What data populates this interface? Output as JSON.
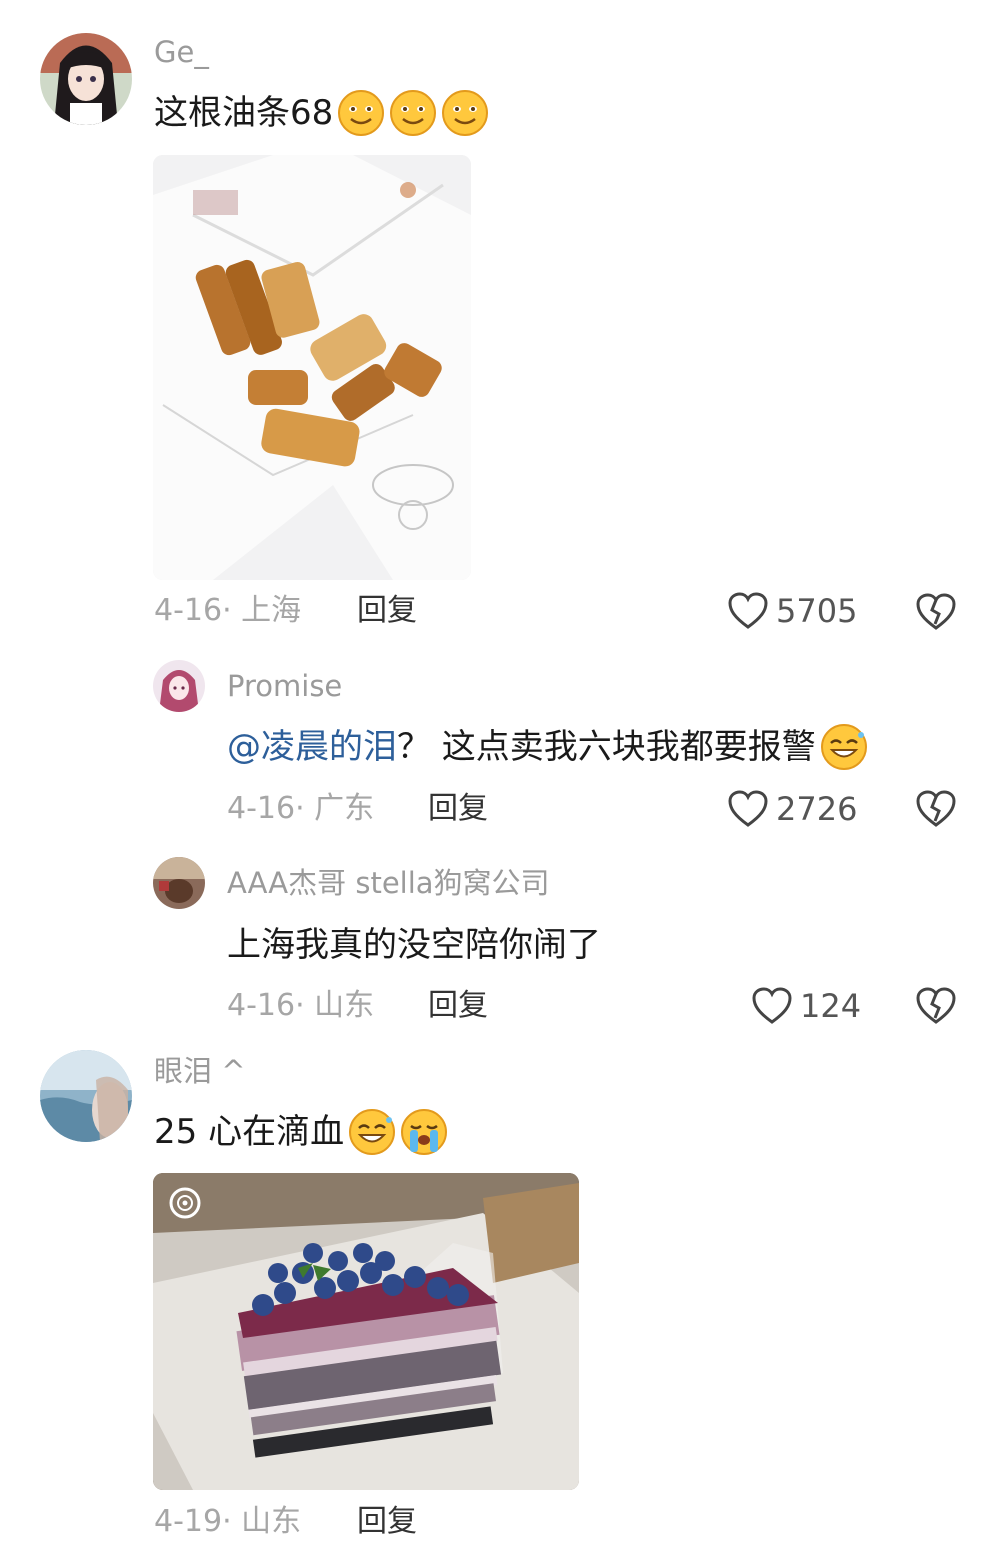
{
  "comments": [
    {
      "username": "Ge_",
      "text": "这根油条68",
      "date_location": "4-16· 上海",
      "reply_label": "回复",
      "likes": "5705"
    },
    {
      "username": "Promise",
      "mention": "@凌晨的泪",
      "text": "？ 这点卖我六块我都要报警",
      "date_location": "4-16· 广东",
      "reply_label": "回复",
      "likes": "2726"
    },
    {
      "username": "AAA杰哥 stella狗窝公司",
      "text": "上海我真的没空陪你闹了",
      "date_location": "4-16· 山东",
      "reply_label": "回复",
      "likes": "124"
    },
    {
      "username": "眼泪 ^",
      "text": "25 心在滴血",
      "date_location": "4-19· 山东",
      "reply_label": "回复"
    }
  ],
  "icons": {
    "like": "heart-outline-icon",
    "dislike": "broken-heart-icon",
    "emoji_smile": "smiling-emoji-icon",
    "emoji_cry": "crying-emoji-icon"
  },
  "colors": {
    "mention": "#2d5f9a",
    "username": "#9a9a9a",
    "meta": "#a6a6a6"
  }
}
